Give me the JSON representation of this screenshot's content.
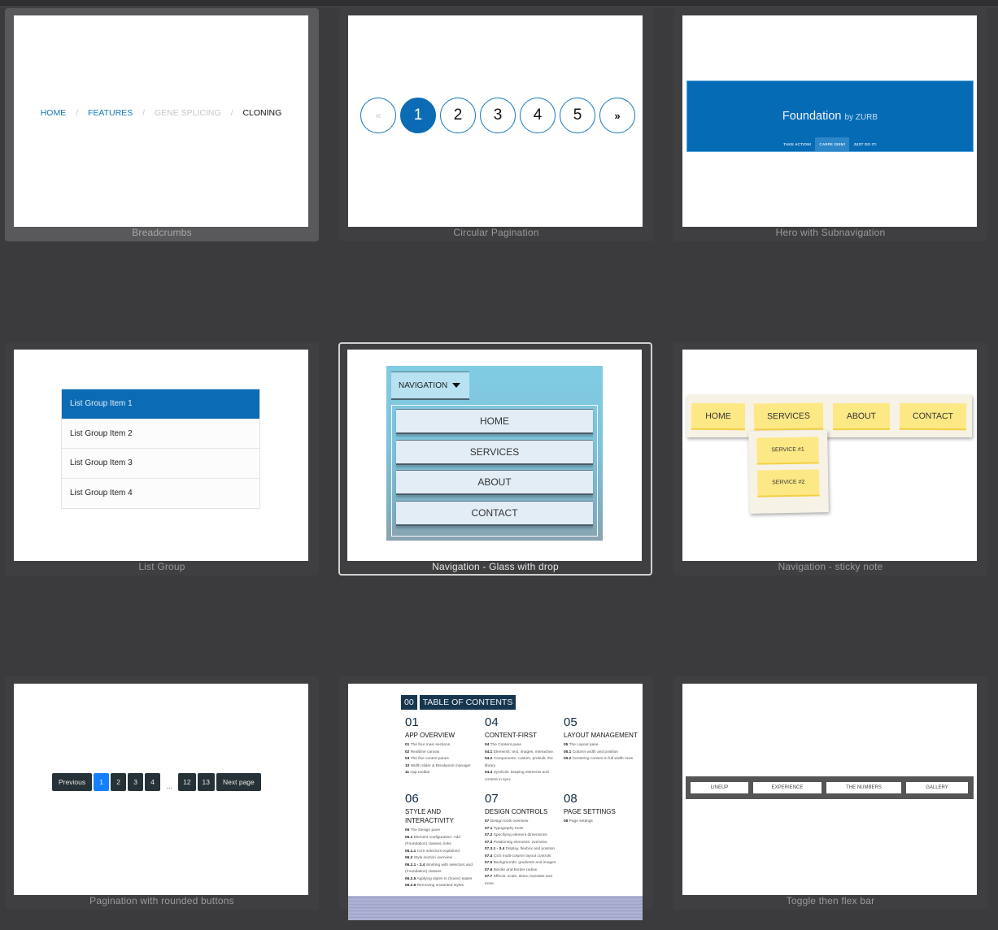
{
  "tiles": [
    {
      "id": "breadcrumbs",
      "caption": "Breadcrumbs",
      "state": "selected",
      "breadcrumbs": [
        {
          "label": "HOME",
          "type": "link"
        },
        {
          "label": "FEATURES",
          "type": "link"
        },
        {
          "label": "GENE SPLICING",
          "type": "disabled"
        },
        {
          "label": "CLONING",
          "type": "current"
        }
      ],
      "separator": "/"
    },
    {
      "id": "circular-pagination",
      "caption": "Circular Pagination",
      "pages": [
        "«",
        "1",
        "2",
        "3",
        "4",
        "5",
        "»"
      ],
      "active_page": "1"
    },
    {
      "id": "hero-subnav",
      "caption": "Hero with Subnavigation",
      "title": "Foundation",
      "title_suffix": "by ZURB",
      "subnav": [
        "TAKE ACTION!",
        "CARPE DIEM!",
        "JUST DO IT!"
      ],
      "active_subnav": "CARPE DIEM!"
    },
    {
      "id": "list-group",
      "caption": "List Group",
      "items": [
        "List Group Item 1",
        "List Group Item 2",
        "List Group Item 3",
        "List Group Item 4"
      ],
      "active_item": "List Group Item 1"
    },
    {
      "id": "nav-glass",
      "caption": "Navigation - Glass with drop",
      "state": "focused",
      "toggle_label": "NAVIGATION",
      "items": [
        "HOME",
        "SERVICES",
        "ABOUT",
        "CONTACT"
      ]
    },
    {
      "id": "nav-sticky",
      "caption": "Navigation - sticky note",
      "items": [
        "HOME",
        "SERVICES",
        "ABOUT",
        "CONTACT"
      ],
      "subitems": [
        "SERVICE #1",
        "SERVICE #2"
      ]
    },
    {
      "id": "rounded-pagination",
      "caption": "Pagination with rounded buttons",
      "previous": "Previous",
      "pages_start": [
        "1",
        "2",
        "3",
        "4"
      ],
      "ellipsis": "...",
      "pages_end": [
        "12",
        "13"
      ],
      "next": "Next page",
      "active_page": "1"
    },
    {
      "id": "toc",
      "caption": "",
      "head_num": "00",
      "head_title": "TABLE OF CONTENTS",
      "sections": [
        {
          "num": "01",
          "title": "APP OVERVIEW",
          "lines": [
            [
              "01",
              "The four main sections"
            ],
            [
              "02",
              "Realtime canvas"
            ],
            [
              "03",
              "The five control panes"
            ],
            [
              "10",
              "Width slider & Breakpoint manager"
            ],
            [
              "11",
              "App toolbar"
            ]
          ]
        },
        {
          "num": "04",
          "title": "CONTENT-FIRST",
          "lines": [
            [
              "04",
              "The Content pane"
            ],
            [
              "04.1",
              "Elements: text, images, interactive."
            ],
            [
              "04.2",
              "Components: custom, prebuilt, the library"
            ],
            [
              "04.3",
              "Symbols: keeping elements and content in sync"
            ]
          ]
        },
        {
          "num": "05",
          "title": "LAYOUT MANAGEMENT",
          "lines": [
            [
              "05",
              "The Layout pane"
            ],
            [
              "05.1",
              "Column width and position"
            ],
            [
              "05.2",
              "Centering content in full width rows"
            ]
          ]
        },
        {
          "num": "06",
          "title": "STYLE AND INTERACTIVITY",
          "lines": [
            [
              "06",
              "The Design pane"
            ],
            [
              "06.1",
              "Element configuration: Add (Foundation) classes, links"
            ],
            [
              "06.1.1",
              "CSS selectors explained"
            ],
            [
              "06.2",
              "Style section overview"
            ],
            [
              "06.2.1 - 2.4",
              "Working with selectors and (Foundation) classes"
            ],
            [
              "06.2.5",
              "Applying styles to (hover) states"
            ],
            [
              "06.2.6",
              "Removing unwanted styles"
            ]
          ]
        },
        {
          "num": "07",
          "title": "DESIGN CONTROLS",
          "lines": [
            [
              "07",
              "Design tools overview"
            ],
            [
              "07.1",
              "Typography tools"
            ],
            [
              "07.2",
              "Specifying element dimensions"
            ],
            [
              "07.3",
              "Positioning elements: overview"
            ],
            [
              "07.3.1 - 3.4",
              "Display, flexbox and position"
            ],
            [
              "07.4",
              "CSS multi-column layout controls"
            ],
            [
              "07.5",
              "Backgrounds: gradients and images"
            ],
            [
              "07.6",
              "Border and border radius"
            ],
            [
              "07.7",
              "Effects: scale, skew, translate and more"
            ]
          ]
        },
        {
          "num": "08",
          "title": "PAGE SETTINGS",
          "lines": [
            [
              "08",
              "Page settings"
            ]
          ]
        }
      ]
    },
    {
      "id": "toggle-flex",
      "caption": "Toggle then flex bar",
      "items": [
        "LINEUP",
        "EXPERIENCE",
        "THE NUMBERS",
        "GALLERY"
      ]
    }
  ],
  "colors": {
    "background": "#3b3b3d",
    "foundation_blue": "#0b6cb5",
    "link_blue": "#1779ba",
    "sticky_yellow": "#fde886",
    "pagination_dark": "#263238",
    "pagination_active": "#1480ff",
    "toc_navy": "#17364f"
  }
}
